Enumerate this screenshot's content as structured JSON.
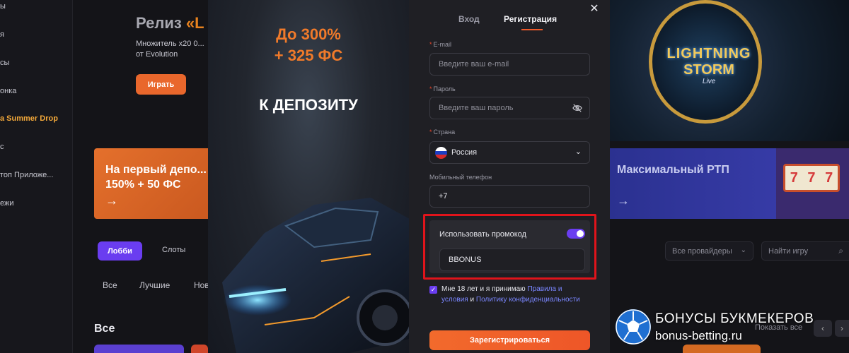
{
  "sidebar": {
    "items": [
      {
        "label": "ы"
      },
      {
        "label": "я"
      },
      {
        "label": "сы"
      },
      {
        "label": "онка"
      },
      {
        "label": "a Summer Drop"
      },
      {
        "label": "с"
      },
      {
        "label": "топ Приложе..."
      },
      {
        "label": "ежи"
      }
    ]
  },
  "hero": {
    "title_prefix": "Релиз ",
    "title_quote": "«L",
    "subtitle": "Множитель x20 0... от Evolution",
    "play_label": "Играть"
  },
  "promo_banner_left": {
    "text": "На первый депо... 150% + 50 ФС",
    "arrow": "→"
  },
  "lobby": {
    "tabs": [
      {
        "label": "Лобби"
      },
      {
        "label": "Слоты"
      }
    ],
    "filters": [
      {
        "label": "Все"
      },
      {
        "label": "Лучшие"
      },
      {
        "label": "Нов"
      }
    ],
    "section_title": "Все",
    "providers_placeholder": "Все провайдеры",
    "search_placeholder": "Найти игру",
    "show_all": "Показать все"
  },
  "right_game": {
    "line1": "LIGHTNING",
    "line2": "STORM",
    "line3": "Live"
  },
  "rtp_banner": {
    "title": "Максимальный РТП",
    "arrow": "→"
  },
  "modal": {
    "offer": {
      "line1": "До 300%",
      "line2": "+ 325 ФС",
      "line3": "К ДЕПОЗИТУ"
    },
    "tabs": {
      "login": "Вход",
      "register": "Регистрация"
    },
    "close_label": "✕",
    "fields": {
      "email": {
        "label": "E-mail",
        "placeholder": "Введите ваш e-mail"
      },
      "password": {
        "label": "Пароль",
        "placeholder": "Введите ваш пароль"
      },
      "country": {
        "label": "Страна",
        "value": "Россия"
      },
      "phone": {
        "label": "Мобильный телефон",
        "value": "+7"
      }
    },
    "promo": {
      "label": "Использовать промокод",
      "enabled": true,
      "value": "BBONUS"
    },
    "terms": {
      "text1": "Мне 18 лет и я принимаю ",
      "link1": "Правила и условия",
      "text2": " и ",
      "link2": "Политику конфиденциальности"
    },
    "submit_label": "Зарегистрироваться"
  },
  "watermark": {
    "line1": "БОНУСЫ БУКМЕКЕРОВ",
    "line2": "bonus-betting.ru"
  },
  "colors": {
    "accent_orange": "#ef5a2a",
    "accent_purple": "#6a3df0",
    "highlight_red": "#e0141b"
  }
}
